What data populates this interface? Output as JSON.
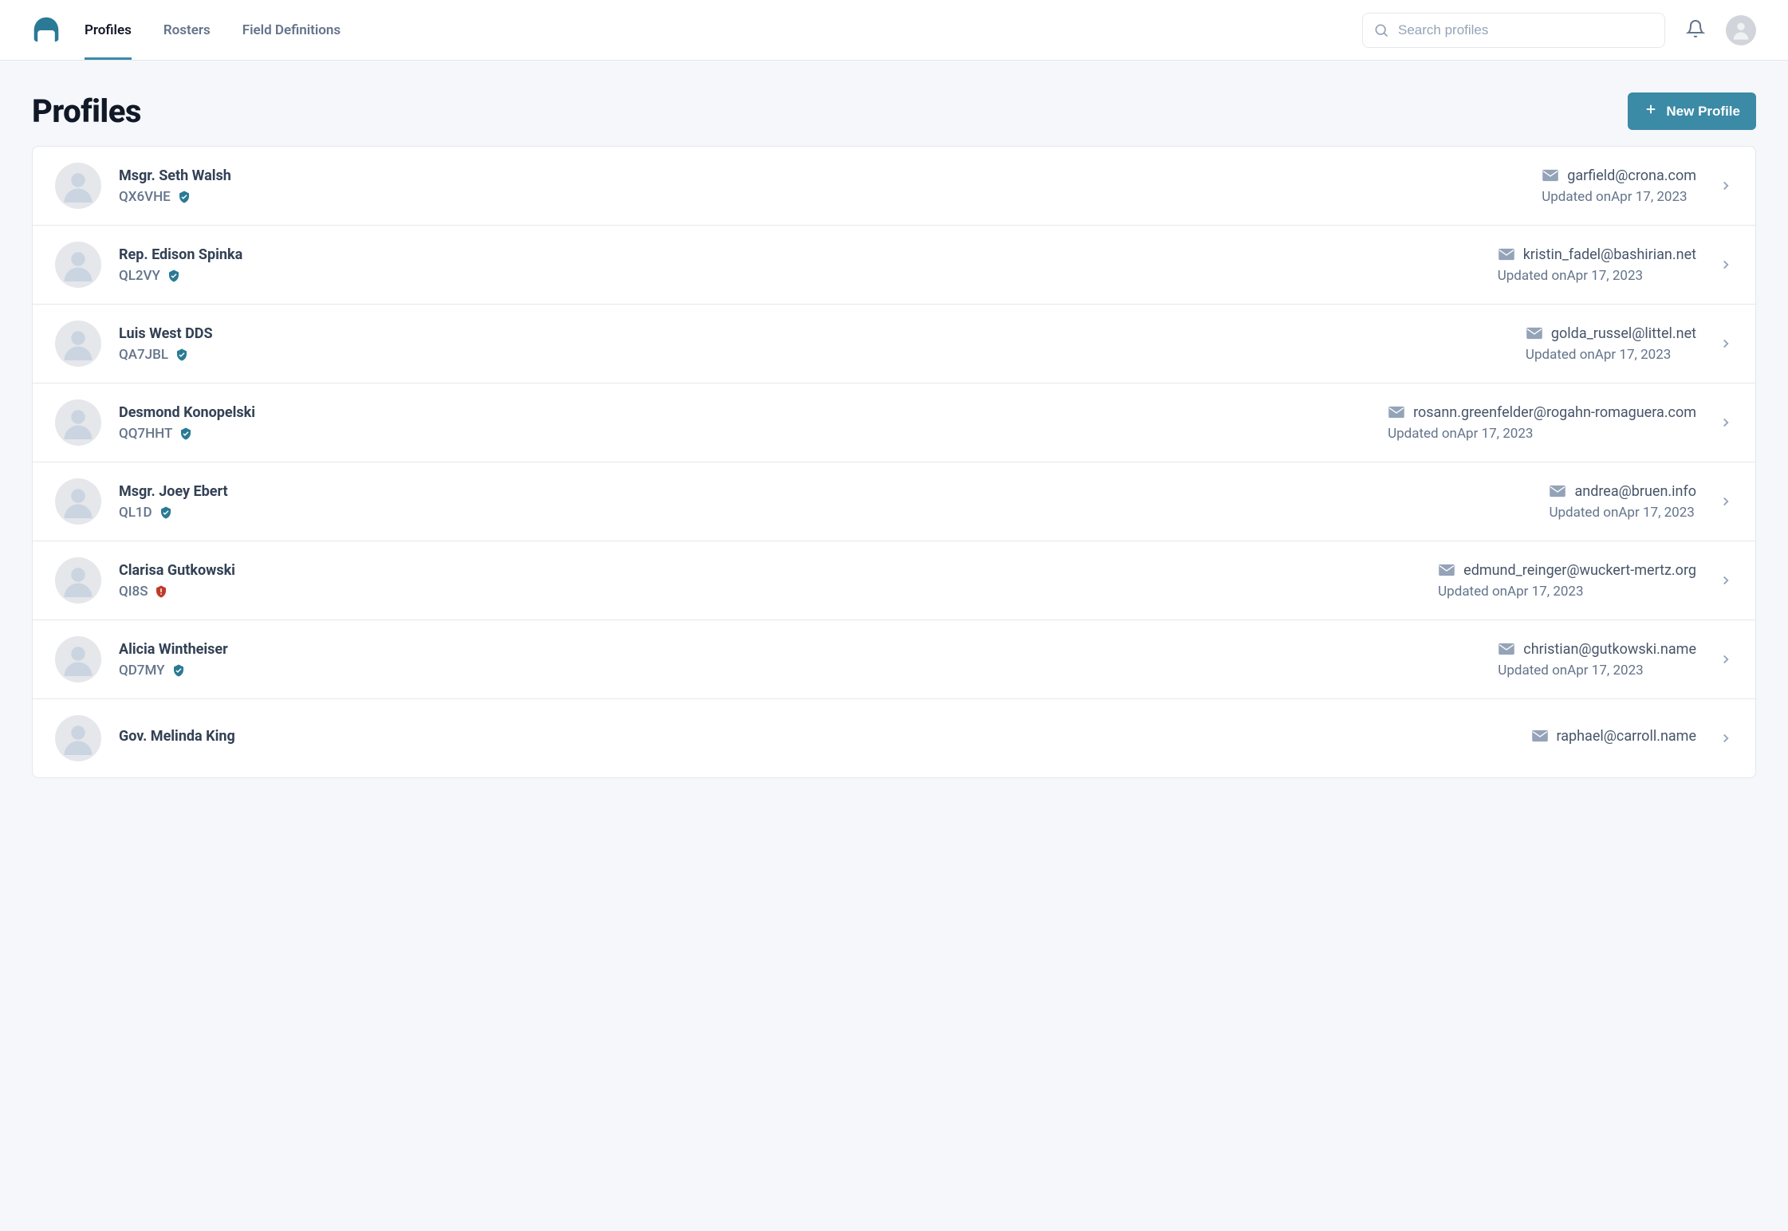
{
  "nav": {
    "profiles": "Profiles",
    "rosters": "Rosters",
    "field_definitions": "Field Definitions"
  },
  "search": {
    "placeholder": "Search profiles"
  },
  "page": {
    "title": "Profiles",
    "new_button": "New Profile",
    "updated_prefix": "Updated on"
  },
  "profiles": [
    {
      "name": "Msgr. Seth Walsh",
      "code": "QX6VHE",
      "badge": "verified",
      "email": "garfield@crona.com",
      "updated": "Apr 17, 2023"
    },
    {
      "name": "Rep. Edison Spinka",
      "code": "QL2VY",
      "badge": "verified",
      "email": "kristin_fadel@bashirian.net",
      "updated": "Apr 17, 2023"
    },
    {
      "name": "Luis West DDS",
      "code": "QA7JBL",
      "badge": "verified",
      "email": "golda_russel@littel.net",
      "updated": "Apr 17, 2023"
    },
    {
      "name": "Desmond Konopelski",
      "code": "QQ7HHT",
      "badge": "verified",
      "email": "rosann.greenfelder@rogahn-romaguera.com",
      "updated": "Apr 17, 2023"
    },
    {
      "name": "Msgr. Joey Ebert",
      "code": "QL1D",
      "badge": "verified",
      "email": "andrea@bruen.info",
      "updated": "Apr 17, 2023"
    },
    {
      "name": "Clarisa Gutkowski",
      "code": "QI8S",
      "badge": "warning",
      "email": "edmund_reinger@wuckert-mertz.org",
      "updated": "Apr 17, 2023"
    },
    {
      "name": "Alicia Wintheiser",
      "code": "QD7MY",
      "badge": "verified",
      "email": "christian@gutkowski.name",
      "updated": "Apr 17, 2023"
    },
    {
      "name": "Gov. Melinda King",
      "code": "",
      "badge": "verified",
      "email": "raphael@carroll.name",
      "updated": ""
    }
  ],
  "colors": {
    "accent": "#3b8aa6",
    "warning": "#c0392b"
  }
}
